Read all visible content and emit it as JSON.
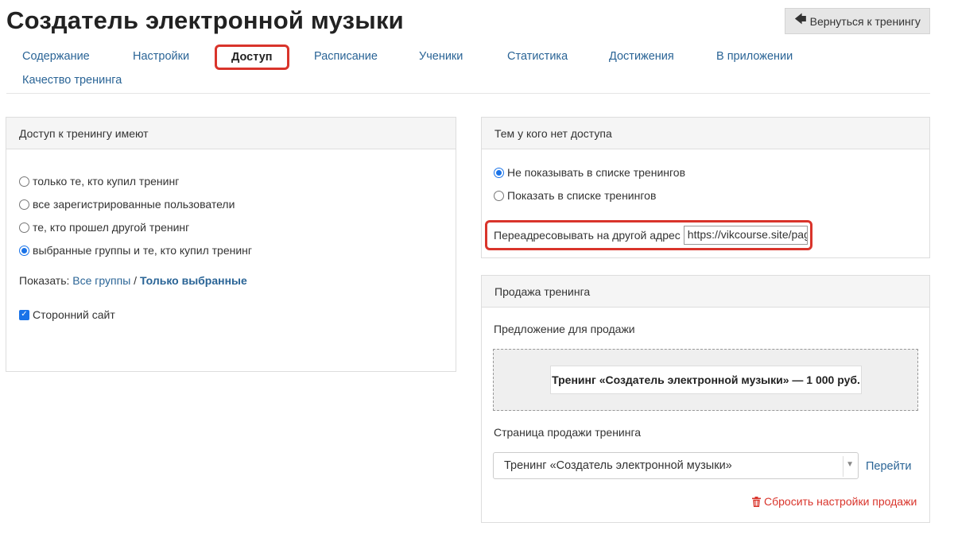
{
  "page": {
    "title": "Создатель электронной музыки",
    "back_button": "Вернуться к тренингу"
  },
  "tabs": [
    {
      "label": "Содержание"
    },
    {
      "label": "Настройки"
    },
    {
      "label": "Доступ",
      "active": true
    },
    {
      "label": "Расписание"
    },
    {
      "label": "Ученики"
    },
    {
      "label": "Статистика"
    },
    {
      "label": "Достижения"
    },
    {
      "label": "В приложении"
    },
    {
      "label": "Качество тренинга"
    }
  ],
  "access_panel": {
    "header": "Доступ к тренингу имеют",
    "options": [
      {
        "label": "только те, кто купил тренинг",
        "checked": false
      },
      {
        "label": "все зарегистрированные пользователи",
        "checked": false
      },
      {
        "label": "те, кто прошел другой тренинг",
        "checked": false
      },
      {
        "label": "выбранные группы и те, кто купил тренинг",
        "checked": true
      }
    ],
    "show_label": "Показать:",
    "show_all_groups": "Все группы",
    "show_separator": "/",
    "show_selected": "Только выбранные",
    "third_party_site": {
      "label": "Сторонний сайт",
      "checked": true
    }
  },
  "no_access_panel": {
    "header": "Тем у кого нет доступа",
    "options": [
      {
        "label": "Не показывать в списке тренингов",
        "checked": true
      },
      {
        "label": "Показать в списке тренингов",
        "checked": false
      }
    ],
    "redirect_label": "Переадресовывать на другой адрес",
    "redirect_value": "https://vikcourse.site/pag"
  },
  "sale_panel": {
    "header": "Продажа тренинга",
    "offer_label": "Предложение для продажи",
    "offer_item": "Тренинг «Создатель электронной музыки» — 1 000 руб.",
    "sale_page_label": "Страница продажи тренинга",
    "sale_page_value": "Тренинг «Создатель электронной музыки»",
    "go_link": "Перейти",
    "reset_link": "Сбросить настройки продажи"
  },
  "colors": {
    "accent_blue": "#1a73e8",
    "link": "#2a6496",
    "highlight_red": "#d9342b"
  }
}
